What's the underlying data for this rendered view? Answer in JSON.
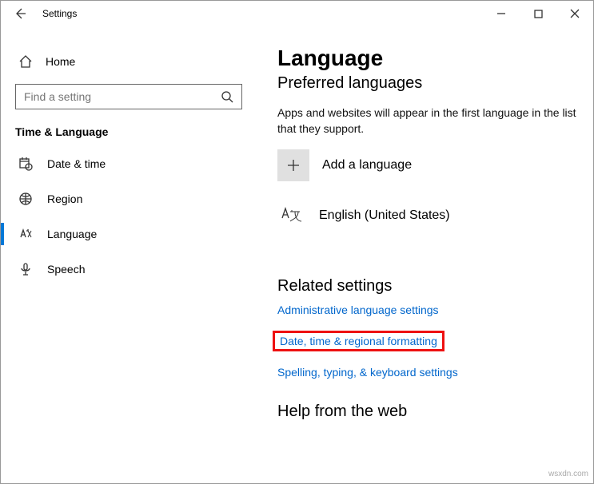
{
  "titlebar": {
    "title": "Settings"
  },
  "sidebar": {
    "home_label": "Home",
    "search_placeholder": "Find a setting",
    "section_title": "Time & Language",
    "items": [
      {
        "label": "Date & time"
      },
      {
        "label": "Region"
      },
      {
        "label": "Language"
      },
      {
        "label": "Speech"
      }
    ]
  },
  "main": {
    "heading": "Language",
    "subheading": "Preferred languages",
    "description": "Apps and websites will appear in the first language in the list that they support.",
    "add_language_label": "Add a language",
    "languages": [
      {
        "name": "English (United States)"
      }
    ],
    "related_heading": "Related settings",
    "links": [
      {
        "label": "Administrative language settings"
      },
      {
        "label": "Date, time & regional formatting"
      },
      {
        "label": "Spelling, typing, & keyboard settings"
      }
    ],
    "help_heading": "Help from the web"
  },
  "watermark": "wsxdn.com"
}
